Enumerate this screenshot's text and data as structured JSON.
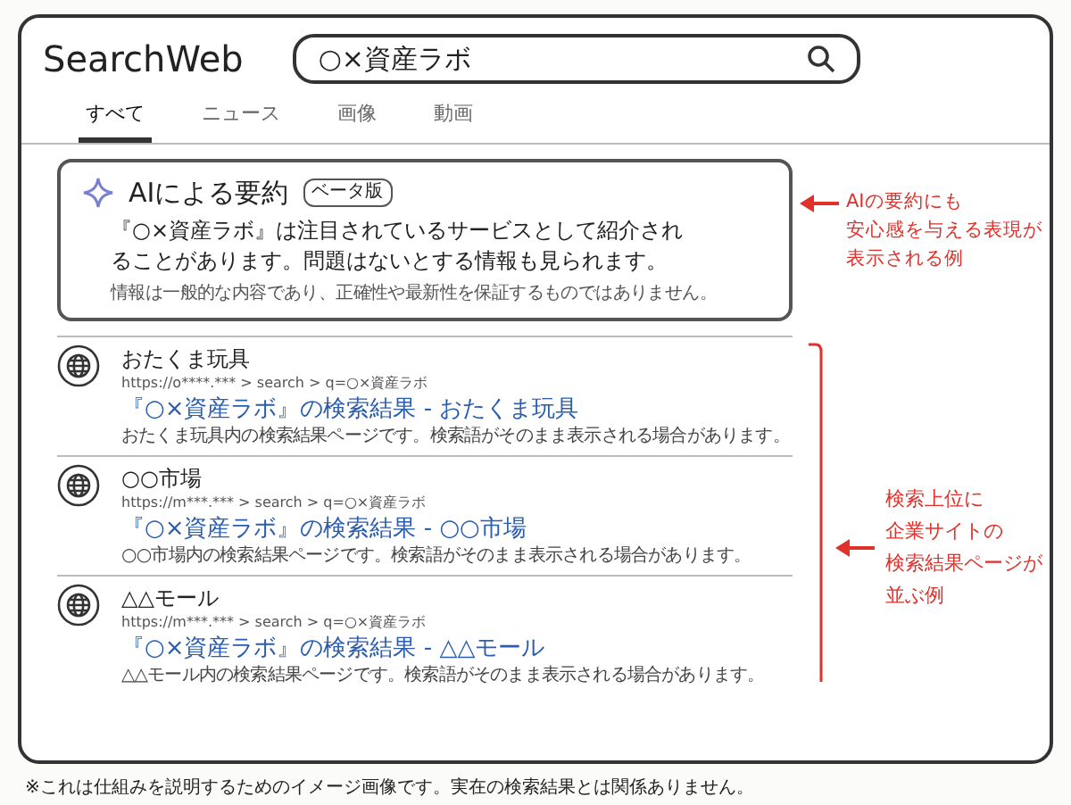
{
  "logo": "SearchWeb",
  "search": {
    "value": "○×資産ラボ"
  },
  "tabs": [
    {
      "label": "すべて",
      "selected": true
    },
    {
      "label": "ニュース",
      "selected": false
    },
    {
      "label": "画像",
      "selected": false
    },
    {
      "label": "動画",
      "selected": false
    }
  ],
  "ai_summary": {
    "title": "AIによる要約",
    "badge": "ベータ版",
    "body": "『○×資産ラボ』は注目されているサービスとして紹介されることがあります。問題はないとする情報も見られます。",
    "disclaimer": "情報は一般的な内容であり、正確性や最新性を保証するものではありません。"
  },
  "results": [
    {
      "site": "おたくま玩具",
      "url": "https://o****.*** > search > q=○×資産ラボ",
      "title": "『○×資産ラボ』の検索結果 - おたくま玩具",
      "description": "おたくま玩具内の検索結果ページです。検索語がそのまま表示される場合があります。"
    },
    {
      "site": "○○市場",
      "url": "https://m***.*** > search > q=○×資産ラボ",
      "title": "『○×資産ラボ』の検索結果 - ○○市場",
      "description": "○○市場内の検索結果ページです。検索語がそのまま表示される場合があります。"
    },
    {
      "site": "△△モール",
      "url": "https://m***.*** > search > q=○×資産ラボ",
      "title": "『○×資産ラボ』の検索結果 - △△モール",
      "description": "△△モール内の検索結果ページです。検索語がそのまま表示される場合があります。"
    }
  ],
  "annotations": [
    {
      "lines": [
        "AIの要約にも",
        "安心感を与える表現が",
        "表示される例"
      ]
    },
    {
      "lines": [
        "検索上位に",
        "企業サイトの",
        "検索結果ページが",
        "並ぶ例"
      ]
    }
  ],
  "footnote": "※これは仕組みを説明するためのイメージ画像です。実在の検索結果とは関係ありません。"
}
